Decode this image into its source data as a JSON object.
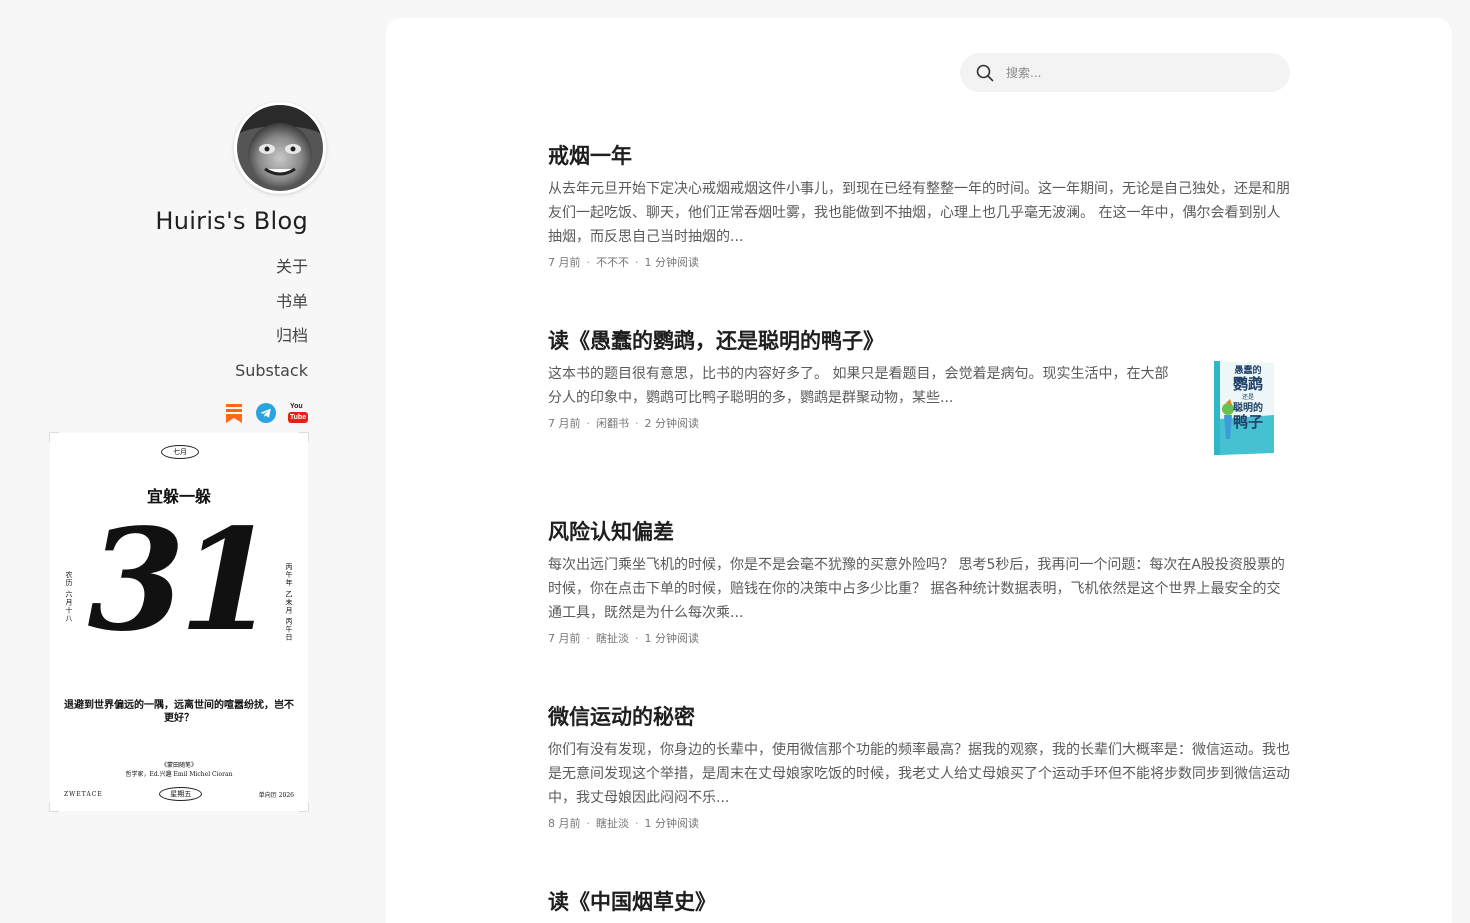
{
  "blog": {
    "title": "Huiris's Blog"
  },
  "nav": [
    {
      "label": "关于"
    },
    {
      "label": "书单"
    },
    {
      "label": "归档"
    },
    {
      "label": "Substack"
    }
  ],
  "social": {
    "icons": [
      "substack-icon",
      "telegram-icon",
      "youtube-icon"
    ],
    "youtube_text": [
      "You",
      "Tube"
    ],
    "colors": {
      "substack": "#ff6719",
      "telegram": "#2aa3df",
      "youtube": "#e62117"
    }
  },
  "calendar": {
    "month": "七月",
    "motto": "宜躲一躲",
    "day": "31",
    "left_vertical": "农历 六月十八",
    "right_vertical": "丙午年 乙未月 丙午日",
    "quote": "退避到世界偏远的一隅，远离世间的喧嚣纷扰，岂不更好？",
    "source_1": "《蒙田随笔》",
    "source_2": "哲学家，Ed.兴趣 Emil Michel Cioran",
    "brand": "ZWETACE",
    "weekday": "星期五",
    "year": "单向历 2026"
  },
  "search": {
    "placeholder": "搜索..."
  },
  "posts": [
    {
      "title": "戒烟一年",
      "excerpt": "从去年元旦开始下定决心戒烟戒烟这件小事儿，到现在已经有整整一年的时间。这一年期间，无论是自己独处，还是和朋友们一起吃饭、聊天，他们正常吞烟吐雾，我也能做到不抽烟，心理上也几乎毫无波澜。 在这一年中，偶尔会看到别人抽烟，而反思自己当时抽烟的...",
      "time": "7 月前",
      "tag": "不不不",
      "read": "1 分钟阅读"
    },
    {
      "title": "读《愚蠢的鹦鹉，还是聪明的鸭子》",
      "excerpt": "这本书的题目很有意思，比书的内容好多了。 如果只是看题目，会觉着是病句。现实生活中，在大部分人的印象中，鹦鹉可比鸭子聪明的多，鹦鹉是群聚动物，某些...",
      "time": "7 月前",
      "tag": "闲翻书",
      "read": "2 分钟阅读",
      "thumb_text": [
        "愚蠢的",
        "鹦鹉",
        "还是",
        "聪明的",
        "鸭子"
      ]
    },
    {
      "title": "风险认知偏差",
      "excerpt": "每次出远门乘坐飞机的时候，你是不是会毫不犹豫的买意外险吗？ 思考5秒后，我再问一个问题：每次在A股投资股票的时候，你在点击下单的时候，赔钱在你的决策中占多少比重？ 据各种统计数据表明，飞机依然是这个世界上最安全的交通工具，既然是为什么每次乘...",
      "time": "7 月前",
      "tag": "瞎扯淡",
      "read": "1 分钟阅读"
    },
    {
      "title": "微信运动的秘密",
      "excerpt": "你们有没有发现，你身边的长辈中，使用微信那个功能的频率最高？据我的观察，我的长辈们大概率是：微信运动。我也是无意间发现这个举措，是周末在丈母娘家吃饭的时候，我老丈人给丈母娘买了个运动手环但不能将步数同步到微信运动中，我丈母娘因此闷闷不乐...",
      "time": "8 月前",
      "tag": "瞎扯淡",
      "read": "1 分钟阅读"
    },
    {
      "title": "读《中国烟草史》"
    }
  ]
}
